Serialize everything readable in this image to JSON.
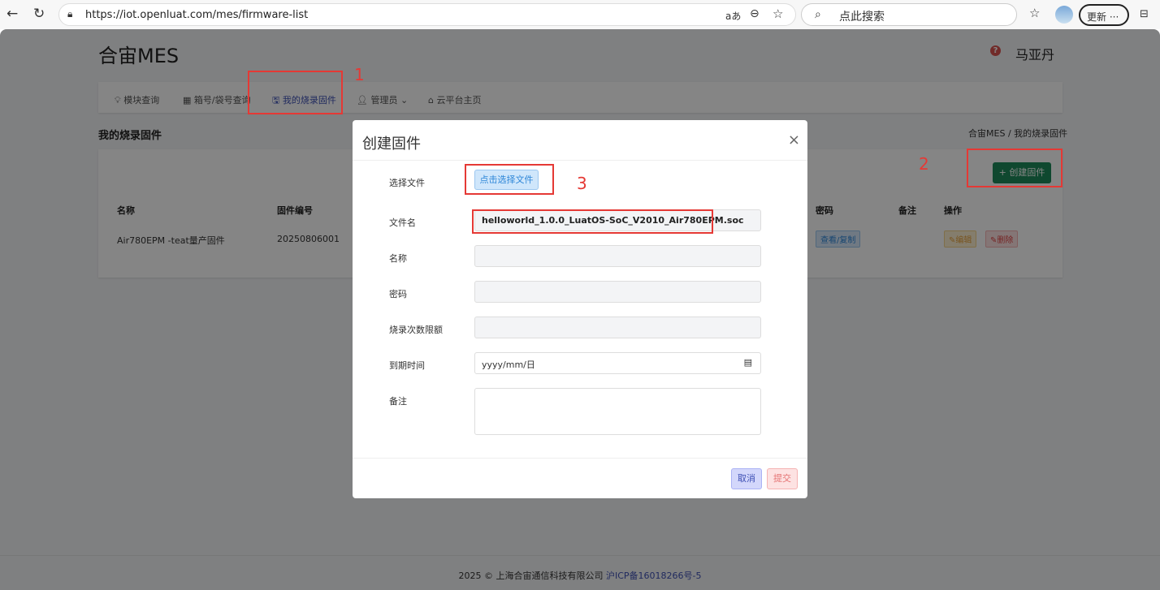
{
  "browser": {
    "url": "https://iot.openluat.com/mes/firmware-list",
    "search_placeholder": "点此搜索",
    "update_label": "更新",
    "more": "···",
    "read_aloud": "aあ"
  },
  "header": {
    "brand": "合宙MES",
    "user": "马亚丹",
    "help": "?"
  },
  "nav": {
    "items": [
      {
        "label": "模块查询",
        "icon": "lightbulb-icon"
      },
      {
        "label": "箱号/袋号查询",
        "icon": "chip-icon"
      },
      {
        "label": "我的烧录固件",
        "icon": "save-icon",
        "active": true
      },
      {
        "label": "管理员",
        "icon": "user-icon"
      },
      {
        "label": "云平台主页",
        "icon": "home-icon"
      }
    ]
  },
  "page": {
    "title": "我的烧录固件",
    "breadcrumb": [
      "合宙MES",
      "我的烧录固件"
    ],
    "breadcrumb_sep": "/",
    "create_button": "+ 创建固件"
  },
  "table": {
    "headers": [
      "名称",
      "固件编号",
      "密码",
      "备注",
      "操作"
    ],
    "rows": [
      {
        "name": "Air780EPM -teat量产固件",
        "id": "20250806001",
        "password_btn": "查看/复制",
        "edit": "编辑",
        "delete": "删除"
      }
    ]
  },
  "modal": {
    "title": "创建固件",
    "close": "×",
    "fields": {
      "file_label": "选择文件",
      "choose_btn": "点击选择文件",
      "filename_label": "文件名",
      "filename_value": "helloworld_1.0.0_LuatOS-SoC_V2010_Air780EPM.soc",
      "name_label": "名称",
      "password_label": "密码",
      "limit_label": "烧录次数限额",
      "expire_label": "到期时间",
      "expire_placeholder": "yyyy/mm/日",
      "remark_label": "备注"
    },
    "cancel": "取消",
    "submit": "提交"
  },
  "annotations": [
    "1",
    "2",
    "3"
  ],
  "footer": {
    "text": "2025 © 上海合宙通信科技有限公司",
    "icp": "沪ICP备16018266号-5"
  },
  "colors": {
    "primary": "#3f51b5",
    "success": "#1e8a5a",
    "annotation": "#e53935"
  }
}
